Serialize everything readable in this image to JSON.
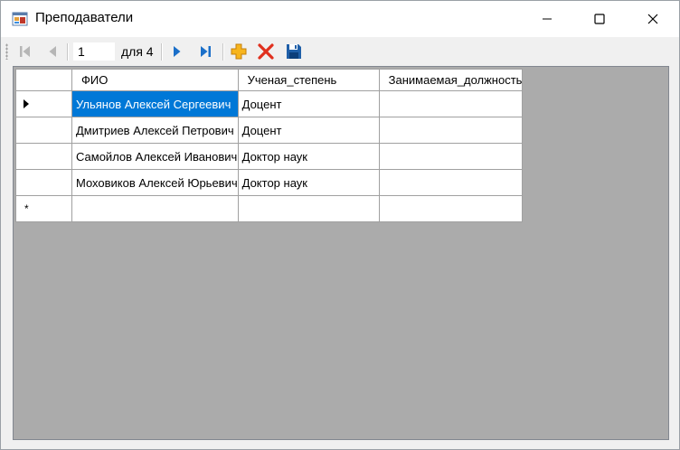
{
  "window": {
    "title": "Преподаватели",
    "icon": "form-app-icon",
    "controls": [
      "minimize-icon",
      "maximize-icon",
      "close-icon"
    ]
  },
  "navigator": {
    "position": "1",
    "count_label": "для 4",
    "buttons": [
      "move-first-icon",
      "move-previous-icon",
      "move-next-icon",
      "move-last-icon",
      "add-new-icon",
      "delete-icon",
      "save-icon"
    ]
  },
  "grid": {
    "columns": [
      "ФИО",
      "Ученая_степень",
      "Занимаемая_должность"
    ],
    "rows": [
      [
        "Ульянов Алексей Сергеевич",
        "Доцент",
        ""
      ],
      [
        "Дмитриев Алексей Петрович",
        "Доцент",
        ""
      ],
      [
        "Самойлов Алексей Иванович",
        "Доктор наук",
        ""
      ],
      [
        "Моховиков Алексей Юрьевич",
        "Доктор наук",
        ""
      ]
    ],
    "selected_row": 0,
    "new_row_marker": "*"
  },
  "colors": {
    "selection": "#0078d7",
    "grid_background": "#ababab",
    "nav_blue": "#1a6fc9",
    "add_icon": "#f7b51d",
    "delete_icon": "#e0301e"
  }
}
